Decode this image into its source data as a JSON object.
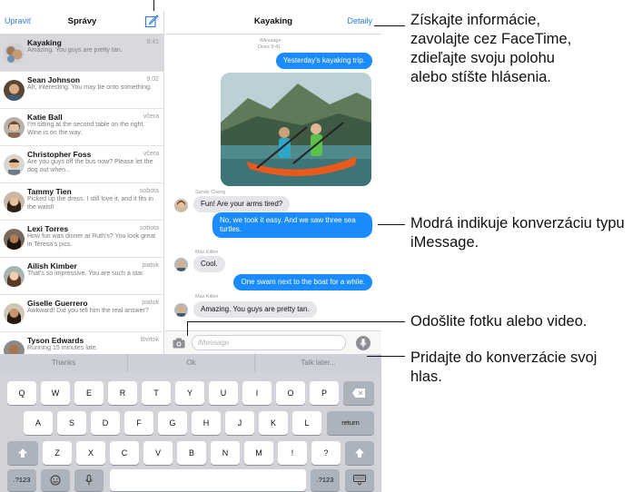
{
  "list": {
    "edit_label": "Upraviť",
    "title": "Správy",
    "conversations": [
      {
        "name": "Kayaking",
        "time": "9:41",
        "preview": "Amazing. You guys are pretty tan."
      },
      {
        "name": "Sean Johnson",
        "time": "9:02",
        "preview": "Ah, interesting. You may be onto something."
      },
      {
        "name": "Katie Ball",
        "time": "včera",
        "preview": "I'm sitting at the second table on the right. Wine is on the way."
      },
      {
        "name": "Christopher Foss",
        "time": "včera",
        "preview": "Are you guys off the bus now? Please let the dog out when..."
      },
      {
        "name": "Tammy Tien",
        "time": "sobota",
        "preview": "Picked up the dress. I still love it, and it fits in the waist!"
      },
      {
        "name": "Lexi Torres",
        "time": "sobota",
        "preview": "How fun was dinner at Ruth's? You look great in Teresa's pics."
      },
      {
        "name": "Ailish Kimber",
        "time": "piatok",
        "preview": "That's so impressive. You are such a star."
      },
      {
        "name": "Giselle Guerrero",
        "time": "piatok",
        "preview": "Awkward! Did you tell him the real answer?"
      },
      {
        "name": "Tyson Edwards",
        "time": "štvrtok",
        "preview": "Running 15 minutes late."
      }
    ]
  },
  "chat": {
    "title": "Kayaking",
    "details_label": "Detaily",
    "meta_service": "iMessage",
    "meta_time": "Dnes 9:41",
    "messages": [
      {
        "text": "Yesterday's kayaking trip.",
        "sender": ""
      },
      {
        "text": "Fun! Are your arms tired?",
        "sender": "Sandy Cheng"
      },
      {
        "text": "No, we took it easy. And we saw three sea turtles.",
        "sender": ""
      },
      {
        "text": "Cool.",
        "sender": "Max Killen"
      },
      {
        "text": "One swam next to the boat for a while.",
        "sender": ""
      },
      {
        "text": "Amazing. You guys are pretty tan.",
        "sender": "Max Killen"
      }
    ],
    "input_placeholder": "iMessage"
  },
  "keyboard": {
    "predictions": [
      "Thanks",
      "Ok",
      "Talk later..."
    ],
    "row1": [
      "Q",
      "W",
      "E",
      "R",
      "T",
      "Y",
      "U",
      "I",
      "O",
      "P"
    ],
    "row2": [
      "A",
      "S",
      "D",
      "F",
      "G",
      "H",
      "J",
      "K",
      "L"
    ],
    "row3": [
      "Z",
      "X",
      "C",
      "V",
      "B",
      "N",
      "M",
      "!",
      "?"
    ],
    "return_label": "return",
    "numbers_label": ".?123"
  },
  "callouts": {
    "details": "Získajte informácie, zavolajte cez FaceTime, zdieľajte svoju polohu alebo stíšte hlásenia.",
    "imessage": "Modrá indikuje konverzáciu typu iMessage.",
    "photo": "Odošlite fotku alebo video.",
    "voice": "Pridajte do konverzácie svoj hlas."
  },
  "colors": {
    "accent": "#2a7ae4",
    "imessage_bubble": "#1a8cff",
    "incoming_bubble": "#e5e5ea",
    "keyboard_bg": "#d1d3d9"
  },
  "icons": {
    "compose": "compose-icon",
    "camera": "camera-icon",
    "mic": "microphone-icon",
    "delete": "delete-icon",
    "shift": "shift-icon",
    "emoji": "emoji-icon",
    "keyboard_hide": "keyboard-hide-icon"
  }
}
